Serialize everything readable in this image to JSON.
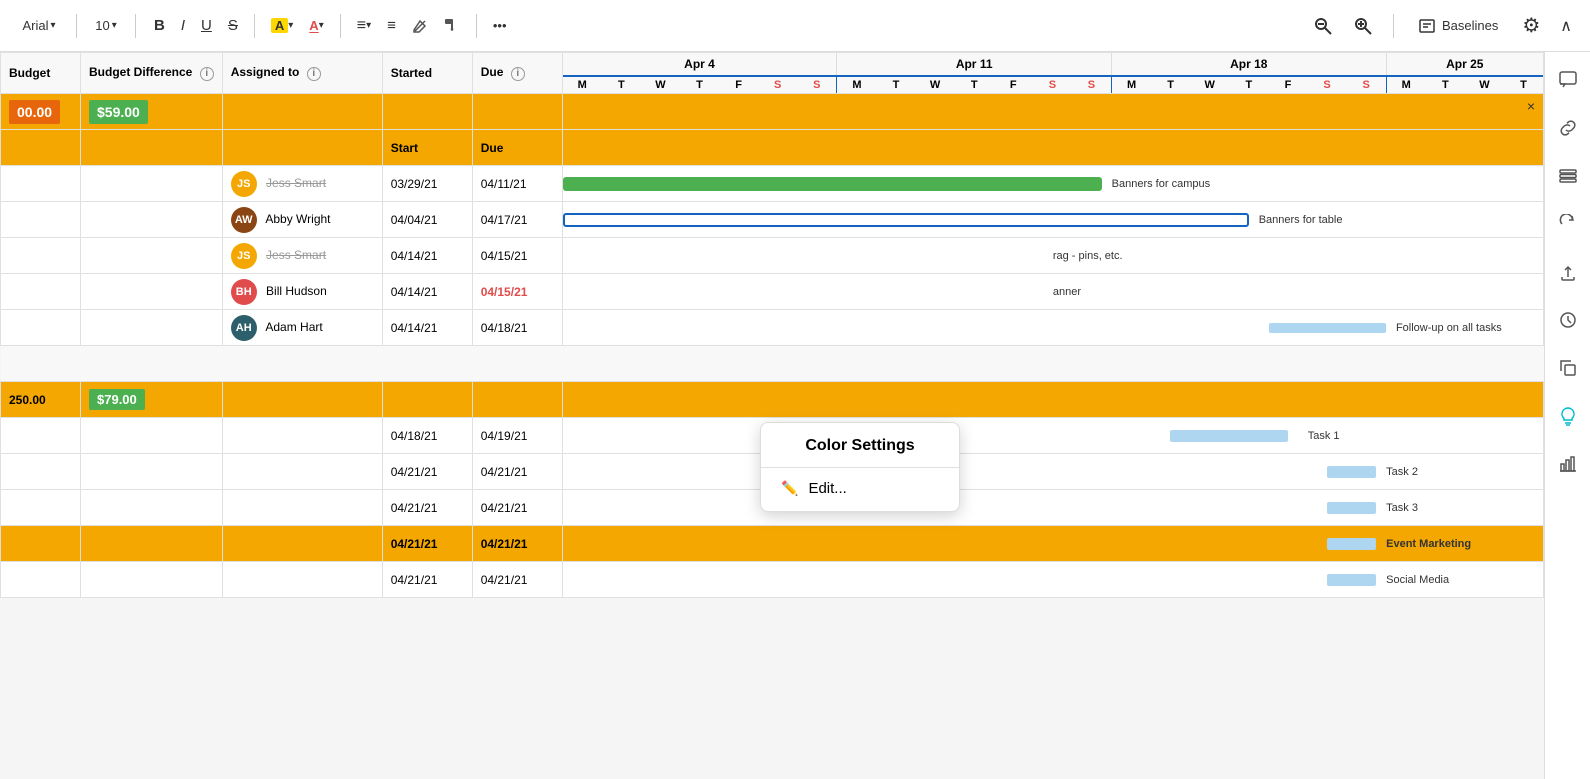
{
  "toolbar": {
    "font_name": "Arial",
    "font_size": "10",
    "bold_label": "B",
    "italic_label": "I",
    "underline_label": "U",
    "strikethrough_label": "S",
    "highlight_label": "A",
    "text_color_label": "A",
    "align_label": "≡",
    "more_label": "•••",
    "zoom_out_label": "−",
    "zoom_in_label": "+",
    "baselines_label": "Baselines",
    "settings_label": "⚙",
    "chevron_up_label": "∧",
    "dropdown_arrow": "▾"
  },
  "columns": {
    "budget": "Budget",
    "budget_difference": "Budget Difference",
    "assigned_to": "Assigned to",
    "started": "Started",
    "due": "Due"
  },
  "weeks": [
    {
      "label": "Apr 4",
      "days": [
        "M",
        "T",
        "W",
        "T",
        "F",
        "S",
        "S"
      ]
    },
    {
      "label": "Apr 11",
      "days": [
        "M",
        "T",
        "W",
        "T",
        "F",
        "S",
        "S"
      ]
    },
    {
      "label": "Apr 18",
      "days": [
        "M",
        "T",
        "W",
        "T",
        "F",
        "S",
        "S"
      ]
    },
    {
      "label": "Apr 25",
      "days": [
        "M",
        "T",
        "W",
        "T"
      ]
    }
  ],
  "rows": [
    {
      "type": "summary-top",
      "budget": "00.00",
      "budget_diff": "$59.00"
    },
    {
      "type": "sub-header",
      "started": "Start",
      "due": "Due"
    },
    {
      "type": "task",
      "assigned_avatar": "JS",
      "assigned_name": "Jess Smart",
      "strikethrough": true,
      "started": "03/29/21",
      "due": "04/11/21",
      "gantt_label": "Banners for campus"
    },
    {
      "type": "task",
      "assigned_avatar": "AW",
      "assigned_name": "Abby Wright",
      "strikethrough": false,
      "started": "04/04/21",
      "due": "04/17/21",
      "gantt_label": "Banners for table"
    },
    {
      "type": "task",
      "assigned_avatar": "JS",
      "assigned_name": "Jess Smart",
      "strikethrough": true,
      "started": "04/14/21",
      "due": "04/15/21",
      "gantt_label": "rag - pins, etc."
    },
    {
      "type": "task",
      "assigned_avatar": "BH",
      "assigned_name": "Bill Hudson",
      "strikethrough": false,
      "started": "04/14/21",
      "due": "04/15/21",
      "due_red": true,
      "gantt_label": "anner"
    },
    {
      "type": "task",
      "assigned_avatar": "AH",
      "assigned_name": "Adam Hart",
      "strikethrough": false,
      "started": "04/14/21",
      "due": "04/18/21",
      "gantt_label": "Follow-up on all tasks"
    },
    {
      "type": "spacer"
    },
    {
      "type": "summary-mid",
      "budget": "250.00",
      "budget_diff": "$79.00"
    },
    {
      "type": "task-plain",
      "started": "04/18/21",
      "due": "04/19/21",
      "gantt_label": "Task 1"
    },
    {
      "type": "task-plain",
      "started": "04/21/21",
      "due": "04/21/21",
      "gantt_label": "Task 2"
    },
    {
      "type": "task-plain",
      "started": "04/21/21",
      "due": "04/21/21",
      "gantt_label": "Task 3"
    },
    {
      "type": "summary-bold",
      "started": "04/21/21",
      "due": "04/21/21",
      "gantt_label": "Event Marketing"
    },
    {
      "type": "task-plain",
      "started": "04/21/21",
      "due": "04/21/21",
      "gantt_label": "Social Media"
    }
  ],
  "context_menu": {
    "color_settings": "Color Settings",
    "edit": "Edit..."
  },
  "sidebar_icons": [
    "comment",
    "link",
    "layers",
    "refresh",
    "upload",
    "clock",
    "copy",
    "lightbulb",
    "chart"
  ]
}
